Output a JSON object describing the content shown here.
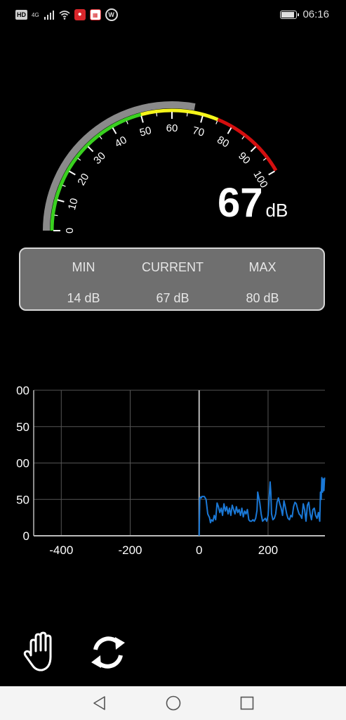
{
  "status_bar": {
    "hd": "HD",
    "network": "4G",
    "time": "06:16",
    "battery_level": 0.9
  },
  "gauge": {
    "min": 0,
    "max": 100,
    "value": 67,
    "tick_labels": [
      "0",
      "10",
      "20",
      "30",
      "40",
      "50",
      "60",
      "70",
      "80",
      "90",
      "100"
    ],
    "colors": {
      "green": "#39d11f",
      "yellow": "#f5f51a",
      "red": "#d40f0f",
      "track": "#8a8a8a"
    },
    "reading": "67",
    "unit": "dB"
  },
  "stats": {
    "min_label": "MIN",
    "min_value": "14 dB",
    "current_label": "CURRENT",
    "current_value": "67 dB",
    "max_label": "MAX",
    "max_value": "80 dB"
  },
  "chart_data": {
    "type": "line",
    "title": "",
    "xlabel": "",
    "ylabel": "",
    "xlim": [
      -480,
      365
    ],
    "ylim": [
      0,
      200
    ],
    "y_tick_labels": [
      "0",
      "50",
      "00",
      "50",
      "00"
    ],
    "x_ticks": [
      -400,
      -200,
      0,
      200
    ],
    "grid": true,
    "line_color": "#1a78d6",
    "series": [
      {
        "x": [
          0,
          2,
          4,
          6,
          8,
          15,
          20,
          25,
          30,
          33,
          36,
          40,
          44,
          48,
          52,
          56,
          60,
          64,
          68,
          72,
          76,
          80,
          84,
          88,
          92,
          96,
          100,
          104,
          108,
          112,
          116,
          120,
          124,
          128,
          132,
          136,
          140,
          144,
          148,
          152,
          156,
          160,
          164,
          168,
          170,
          172,
          176,
          180,
          184,
          188,
          192,
          196,
          200,
          204,
          206,
          208,
          210,
          214,
          218,
          222,
          226,
          230,
          234,
          238,
          242,
          246,
          250,
          254,
          258,
          262,
          266,
          270,
          274,
          278,
          282,
          286,
          290,
          294,
          298,
          302,
          306,
          310,
          314,
          318,
          322,
          326,
          330,
          334,
          338,
          342,
          346,
          350,
          352,
          354,
          356,
          358,
          360,
          362,
          364
        ],
        "y": [
          0,
          52,
          53,
          52,
          54,
          54,
          50,
          30,
          25,
          18,
          22,
          20,
          28,
          22,
          45,
          40,
          32,
          38,
          28,
          44,
          34,
          40,
          30,
          38,
          28,
          42,
          36,
          30,
          40,
          32,
          36,
          28,
          38,
          26,
          34,
          30,
          36,
          22,
          20,
          20,
          22,
          20,
          24,
          35,
          60,
          55,
          45,
          30,
          20,
          22,
          24,
          20,
          28,
          58,
          74,
          60,
          30,
          22,
          24,
          30,
          46,
          52,
          44,
          38,
          28,
          48,
          40,
          30,
          24,
          22,
          28,
          26,
          40,
          46,
          44,
          36,
          30,
          28,
          24,
          44,
          36,
          20,
          42,
          46,
          30,
          22,
          36,
          38,
          28,
          24,
          32,
          20,
          60,
          50,
          80,
          60,
          78,
          62,
          80
        ]
      }
    ]
  },
  "toolbar": {
    "hold_icon": "hand-icon",
    "reset_icon": "refresh-icon"
  },
  "nav": {
    "back_icon": "back-triangle-icon",
    "home_icon": "home-circle-icon",
    "recents_icon": "recents-square-icon"
  }
}
